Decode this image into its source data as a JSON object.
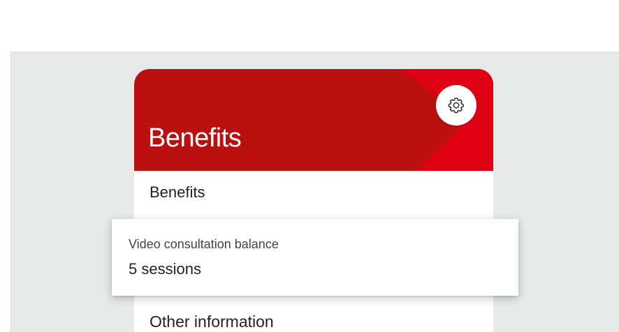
{
  "header": {
    "title": "Benefits",
    "settings_icon": "gear-icon",
    "accent_color": "#bb1010",
    "accent_light_color": "#e00014"
  },
  "benefits_section": {
    "label": "Benefits"
  },
  "balance_card": {
    "label": "Video consultation balance",
    "value": "5 sessions"
  },
  "other_section": {
    "label": "Other information"
  }
}
